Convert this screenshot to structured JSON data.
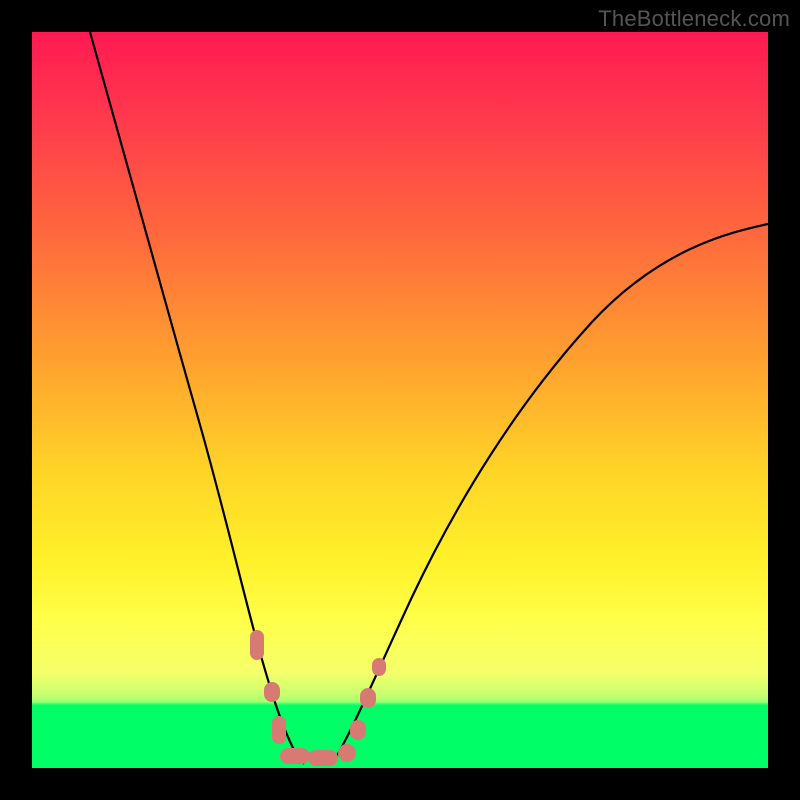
{
  "watermark": "TheBottleneck.com",
  "colors": {
    "frame": "#000000",
    "gradient_top": "#ff1a52",
    "gradient_mid": "#ffd527",
    "gradient_bottom_yellow": "#ffff4a",
    "green_band": "#00ff66",
    "curve_stroke": "#000000",
    "marker_fill": "#d77a74"
  },
  "chart_data": {
    "type": "line",
    "title": "",
    "xlabel": "",
    "ylabel": "",
    "xlim": [
      0,
      100
    ],
    "ylim": [
      0,
      100
    ],
    "notes": "V-shaped bottleneck curve on rainbow background. Y≈100 is max bottleneck (red zone), Y≈0 is optimum (green zone). Curve dips to ~0 near x≈35–42 and rises on both sides. Salmon markers cluster around the minimum.",
    "series": [
      {
        "name": "left-branch",
        "x": [
          8,
          12,
          16,
          20,
          24,
          26,
          28,
          30,
          32,
          34,
          36
        ],
        "values": [
          100,
          85,
          70,
          56,
          42,
          34,
          26,
          18,
          9,
          3,
          0
        ]
      },
      {
        "name": "right-branch",
        "x": [
          40,
          44,
          48,
          52,
          56,
          60,
          65,
          72,
          80,
          90,
          100
        ],
        "values": [
          0,
          5,
          11,
          18,
          25,
          32,
          40,
          49,
          58,
          67,
          74
        ]
      }
    ],
    "markers": [
      {
        "x": 29,
        "y": 18,
        "shape": "pill-vertical"
      },
      {
        "x": 32,
        "y": 9,
        "shape": "oval"
      },
      {
        "x": 33,
        "y": 4,
        "shape": "pill-vertical"
      },
      {
        "x": 34,
        "y": 0,
        "shape": "pill-horizontal"
      },
      {
        "x": 38,
        "y": 0,
        "shape": "pill-horizontal"
      },
      {
        "x": 42,
        "y": 0,
        "shape": "oval"
      },
      {
        "x": 43,
        "y": 4,
        "shape": "oval"
      },
      {
        "x": 44,
        "y": 9,
        "shape": "oval"
      },
      {
        "x": 46,
        "y": 14,
        "shape": "oval"
      }
    ],
    "green_band_y_range": [
      0,
      9
    ]
  }
}
